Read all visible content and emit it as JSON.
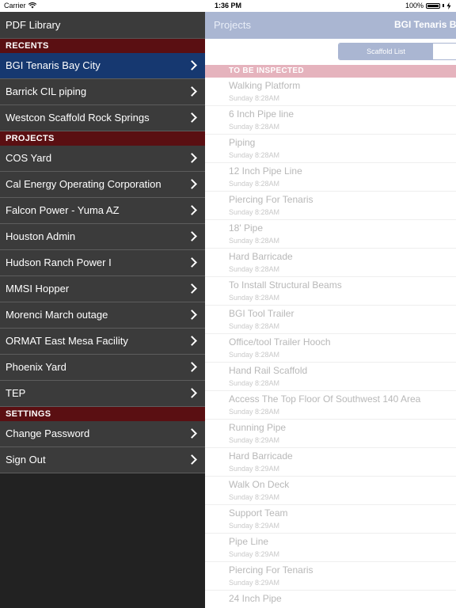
{
  "status": {
    "carrier": "Carrier",
    "time": "1:36 PM",
    "battery": "100%"
  },
  "sidebar": {
    "title": "PDF Library",
    "recents_header": "RECENTS",
    "recents": [
      "BGI Tenaris Bay City",
      "Barrick CIL piping",
      "Westcon Scaffold Rock Springs"
    ],
    "projects_header": "PROJECTS",
    "projects": [
      "COS Yard",
      "Cal Energy Operating Corporation",
      "Falcon Power - Yuma AZ",
      "Houston Admin",
      "Hudson Ranch Power I",
      "MMSI Hopper",
      "Morenci March outage",
      "ORMAT East Mesa Facility",
      "Phoenix Yard",
      "TEP"
    ],
    "settings_header": "SETTINGS",
    "settings": [
      "Change Password",
      "Sign Out"
    ]
  },
  "main": {
    "back_label": "Projects",
    "title": "BGI Tenaris Ba",
    "segment_label": "Scaffold List",
    "section_header": "TO BE INSPECTED",
    "items": [
      {
        "title": "Walking Platform",
        "time": "Sunday 8:28AM"
      },
      {
        "title": "6 Inch Pipe line",
        "time": "Sunday 8:28AM"
      },
      {
        "title": "Piping",
        "time": "Sunday 8:28AM"
      },
      {
        "title": "12 Inch Pipe Line",
        "time": "Sunday 8:28AM"
      },
      {
        "title": "Piercing For Tenaris",
        "time": "Sunday 8:28AM"
      },
      {
        "title": "18' Pipe",
        "time": "Sunday 8:28AM"
      },
      {
        "title": "Hard Barricade",
        "time": "Sunday 8:28AM"
      },
      {
        "title": "To Install Structural Beams",
        "time": "Sunday 8:28AM"
      },
      {
        "title": "BGI Tool Trailer",
        "time": "Sunday 8:28AM"
      },
      {
        "title": "Office/tool Trailer Hooch",
        "time": "Sunday 8:28AM"
      },
      {
        "title": "Hand Rail Scaffold",
        "time": "Sunday 8:28AM"
      },
      {
        "title": "Access The Top Floor Of Southwest 140 Area",
        "time": "Sunday 8:28AM"
      },
      {
        "title": "Running Pipe",
        "time": "Sunday 8:29AM"
      },
      {
        "title": "Hard Barricade",
        "time": "Sunday 8:29AM"
      },
      {
        "title": "Walk On Deck",
        "time": "Sunday 8:29AM"
      },
      {
        "title": "Support Team",
        "time": "Sunday 8:29AM"
      },
      {
        "title": "Pipe Line",
        "time": "Sunday 8:29AM"
      },
      {
        "title": "Piercing For Tenaris",
        "time": "Sunday 8:29AM"
      },
      {
        "title": "24 Inch Pipe",
        "time": ""
      }
    ]
  },
  "colors": {
    "sidebar_bg": "#3b3b3b",
    "sidebar_header": "#5a0f12",
    "active_item": "#163870",
    "nav_bar": "#aab6d2",
    "section_header": "#e5b3bd"
  }
}
